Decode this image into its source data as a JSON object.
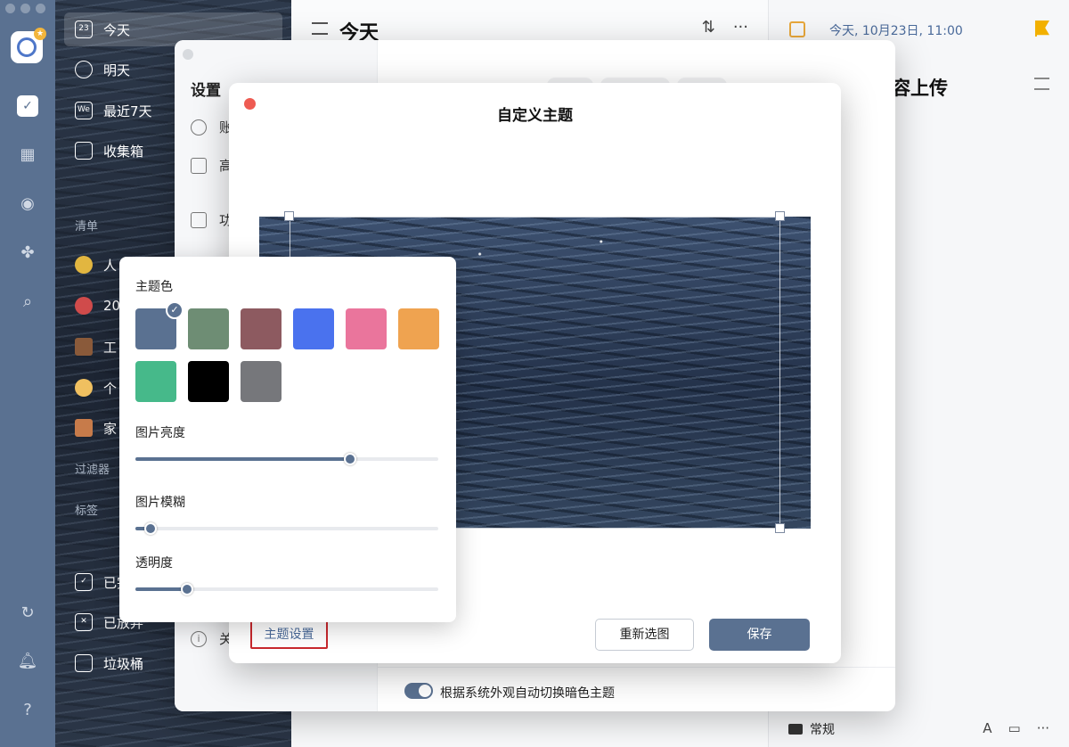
{
  "sidebar": {
    "items": [
      {
        "label": "今天",
        "icon": "calendar-23-icon"
      },
      {
        "label": "明天",
        "icon": "sunrise-icon"
      },
      {
        "label": "最近7天",
        "icon": "week-calendar-icon"
      },
      {
        "label": "收集箱",
        "icon": "inbox-icon"
      }
    ],
    "lists_heading": "清单",
    "lists": [
      {
        "label": "人",
        "icon": "shooting-star-emoji"
      },
      {
        "label": "20",
        "icon": "target-emoji"
      },
      {
        "label": "工",
        "icon": "briefcase-emoji"
      },
      {
        "label": "个",
        "icon": "face-emoji"
      },
      {
        "label": "家",
        "icon": "house-emoji"
      }
    ],
    "filters_heading": "过滤器",
    "tags_heading": "标签",
    "bottom_items": [
      {
        "label": "已完",
        "icon": "checkbox-icon"
      },
      {
        "label": "已放弃",
        "icon": "x-box-icon"
      },
      {
        "label": "垃圾桶",
        "icon": "trash-icon"
      }
    ]
  },
  "main": {
    "title": "今天"
  },
  "detail": {
    "date": "今天, 10月23日, 11:00",
    "heading": "容上传",
    "footer_tab": "常规"
  },
  "settings": {
    "title": "设置",
    "items": [
      {
        "label": "账",
        "icon": "account-icon"
      },
      {
        "label": "高",
        "icon": "crown-icon"
      },
      {
        "label": "功",
        "icon": "grid-icon"
      },
      {
        "label": "关",
        "icon": "info-icon"
      }
    ],
    "auto_dark_label": "根据系统外观自动切换暗色主题",
    "auto_dark_on": true
  },
  "dialog": {
    "title": "自定义主题",
    "reselect_label": "重新选图",
    "save_label": "保存",
    "theme_settings_label": "主题设置"
  },
  "popover": {
    "theme_color_label": "主题色",
    "colors": [
      "#5a7191",
      "#6e8d74",
      "#8d5a60",
      "#4a72ee",
      "#ea759c",
      "#efa350",
      "#46b98a",
      "#000000",
      "#76777b"
    ],
    "selected_color_index": 0,
    "brightness_label": "图片亮度",
    "brightness_value": 0.71,
    "blur_label": "图片模糊",
    "blur_value": 0.05,
    "opacity_label": "透明度",
    "opacity_value": 0.17
  },
  "colors": {
    "accent": "#5a7191",
    "highlight": "#c9282d",
    "close": "#ee5b52",
    "flag": "#f2b000"
  }
}
